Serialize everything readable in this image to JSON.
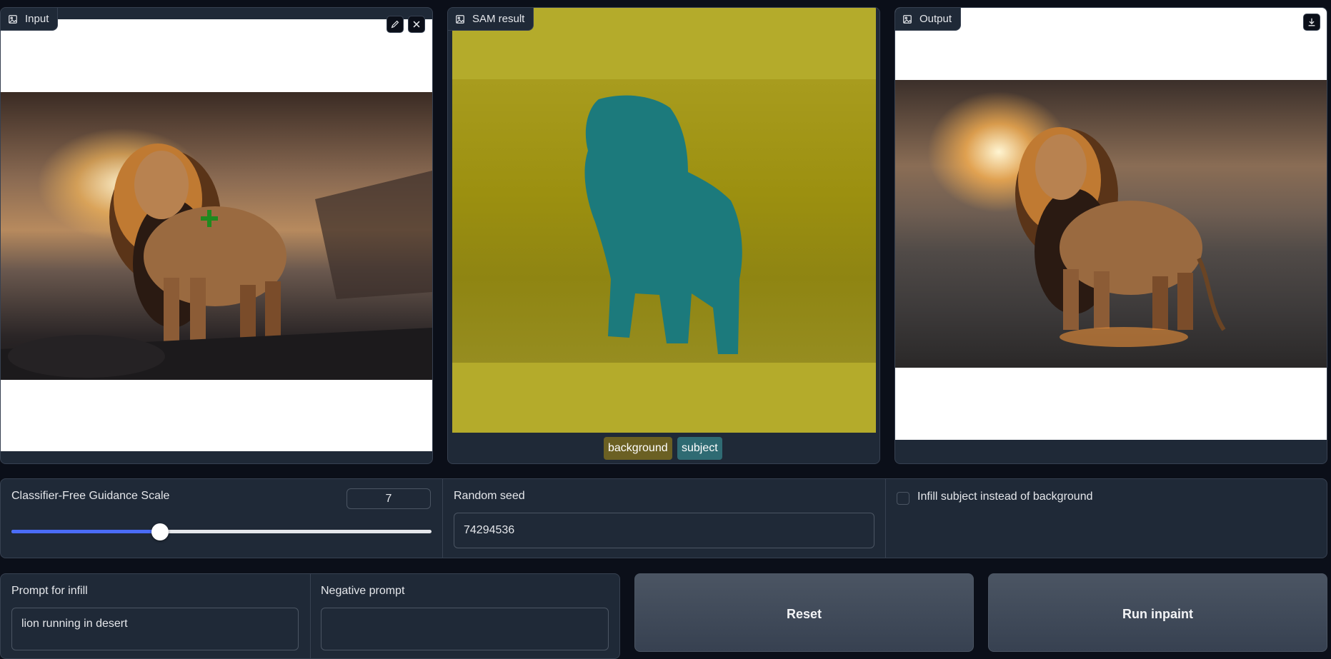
{
  "input_panel": {
    "label": "Input",
    "icon": "image-icon"
  },
  "sam_panel": {
    "label": "SAM result",
    "icon": "image-icon",
    "legend": [
      {
        "label": "background",
        "color": "#6b6023"
      },
      {
        "label": "subject",
        "color": "#2f6b73"
      }
    ],
    "mask_colors": {
      "background": "#b4ab2b",
      "subject": "#1c7a7c"
    }
  },
  "output_panel": {
    "label": "Output",
    "icon": "image-icon"
  },
  "guidance": {
    "label": "Classifier-Free Guidance Scale",
    "value": "7",
    "slider_fraction": 0.35
  },
  "seed": {
    "label": "Random seed",
    "value": "74294536"
  },
  "infill_option": {
    "label": "Infill subject instead of background",
    "checked": false
  },
  "prompt": {
    "label": "Prompt for infill",
    "value": "lion running in desert"
  },
  "negative_prompt": {
    "label": "Negative prompt",
    "value": ""
  },
  "buttons": {
    "reset": "Reset",
    "run": "Run inpaint"
  },
  "colors": {
    "accent": "#4a6cf7",
    "panel": "#1f2937",
    "page": "#0b0f19"
  }
}
